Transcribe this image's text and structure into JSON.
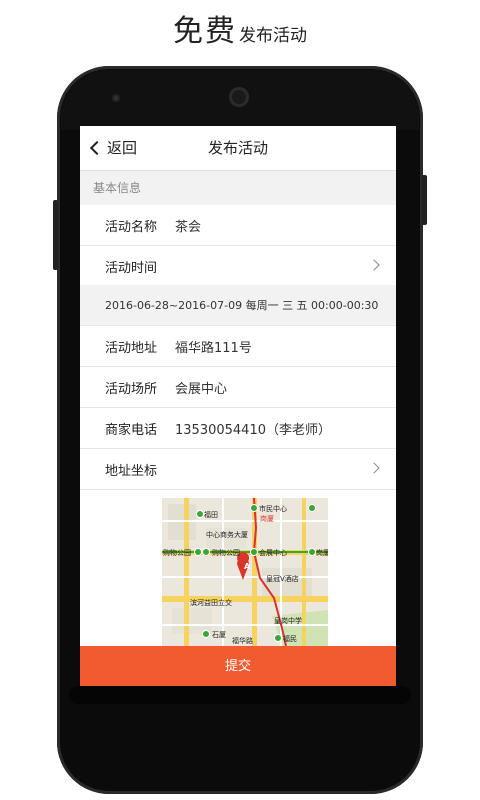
{
  "promo": {
    "big": "免费",
    "small": "发布活动"
  },
  "nav": {
    "back_label": "返回",
    "title": "发布活动"
  },
  "section": {
    "header": "基本信息"
  },
  "form": {
    "name_label": "活动名称",
    "name_value": "茶会",
    "time_label": "活动时间",
    "time_detail": "2016-06-28~2016-07-09 每周一 三 五 00:00-00:30",
    "address_label": "活动地址",
    "address_value": "福华路111号",
    "venue_label": "活动场所",
    "venue_value": "会展中心",
    "phone_label": "商家电话",
    "phone_value": "13530054410（李老师）",
    "coord_label": "地址坐标"
  },
  "map": {
    "labels": {
      "futian": "福田",
      "shiminzhongxin": "市民中心",
      "gangxia": "岗厦",
      "zhongxinshangwu": "中心商务大厦",
      "gouwugongyuan1": "购物公园",
      "gouwugongyuan2": "购物公园",
      "huizhanzhongxin": "会展中心",
      "gangxia2": "岗厦",
      "huangguan": "皇冠V酒店",
      "binhe": "滨河益田立交",
      "shixia": "石厦",
      "fumin": "福民",
      "huangfu": "皇岗中学",
      "fuhua": "福华路"
    },
    "pin_letter": "A",
    "colors": {
      "line1": "#3aa53a",
      "line4": "#d93030",
      "road": "#f5d35e"
    }
  },
  "submit_label": "提交",
  "colors": {
    "accent": "#f25a30"
  }
}
